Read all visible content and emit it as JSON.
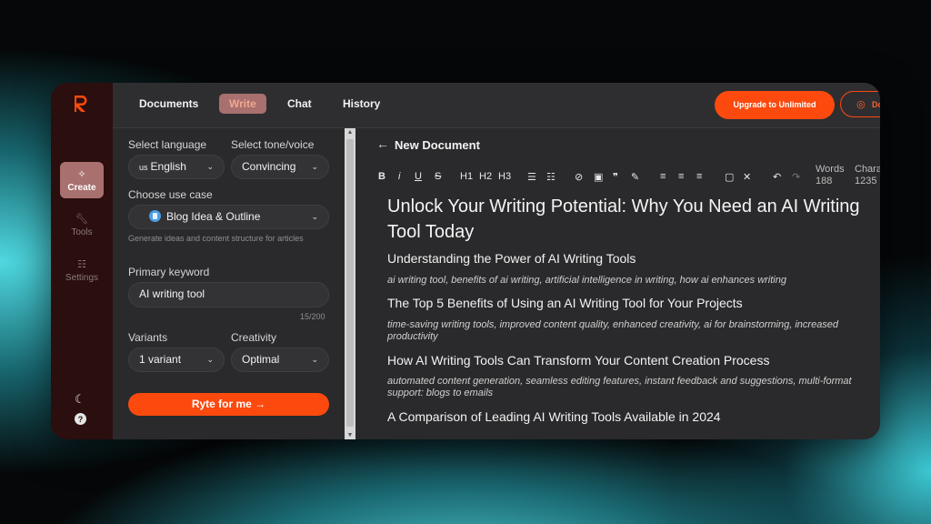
{
  "colors": {
    "accent": "#fc4a0e",
    "rail_bg": "#2b0e0e",
    "active_tab": "#a8706e",
    "panel_bg": "#2a2a2c"
  },
  "rail": {
    "logo": "R",
    "items": [
      {
        "label": "Create",
        "icon": "sparkle-icon"
      },
      {
        "label": "Tools",
        "icon": "wrench-icon"
      },
      {
        "label": "Settings",
        "icon": "sliders-icon"
      }
    ],
    "bottom_icons": [
      "moon-icon",
      "help-icon"
    ]
  },
  "topbar": {
    "tabs": [
      "Documents",
      "Write",
      "Chat",
      "History"
    ],
    "active_tab": "Write",
    "upgrade_label": "Upgrade to Unlimited",
    "download_label": "Download Extens"
  },
  "form": {
    "language_label": "Select language",
    "language_flag": "us",
    "language_value": "English",
    "tone_label": "Select tone/voice",
    "tone_value": "Convincing",
    "usecase_label": "Choose use case",
    "usecase_value": "Blog Idea & Outline",
    "usecase_hint": "Generate ideas and content structure for articles",
    "keyword_label": "Primary keyword",
    "keyword_value": "AI writing tool",
    "keyword_counter": "15/200",
    "variants_label": "Variants",
    "variants_value": "1 variant",
    "creativity_label": "Creativity",
    "creativity_value": "Optimal",
    "submit_label": "Ryte for me →"
  },
  "editor": {
    "title": "New Document",
    "toolbar": [
      "B",
      "i",
      "U",
      "S",
      "H1",
      "H2",
      "H3"
    ],
    "words_label": "Words",
    "words_value": "188",
    "chars_label": "Chara",
    "chars_value": "1235",
    "headline": "Unlock Your Writing Potential: Why You Need an AI Writing Tool Today",
    "sections": [
      {
        "heading": "Understanding the Power of AI Writing Tools",
        "keywords": "ai writing tool, benefits of ai writing, artificial intelligence in writing, how ai enhances writing"
      },
      {
        "heading": "The Top 5 Benefits of Using an AI Writing Tool for Your Projects",
        "keywords": "time-saving writing tools, improved content quality, enhanced creativity, ai for brainstorming, increased productivity"
      },
      {
        "heading": "How AI Writing Tools Can Transform Your Content Creation Process",
        "keywords": "automated content generation, seamless editing features, instant feedback and suggestions, multi-format support: blogs to emails"
      },
      {
        "heading": "A Comparison of Leading AI Writing Tools Available in 2024",
        "keywords": ""
      }
    ]
  }
}
